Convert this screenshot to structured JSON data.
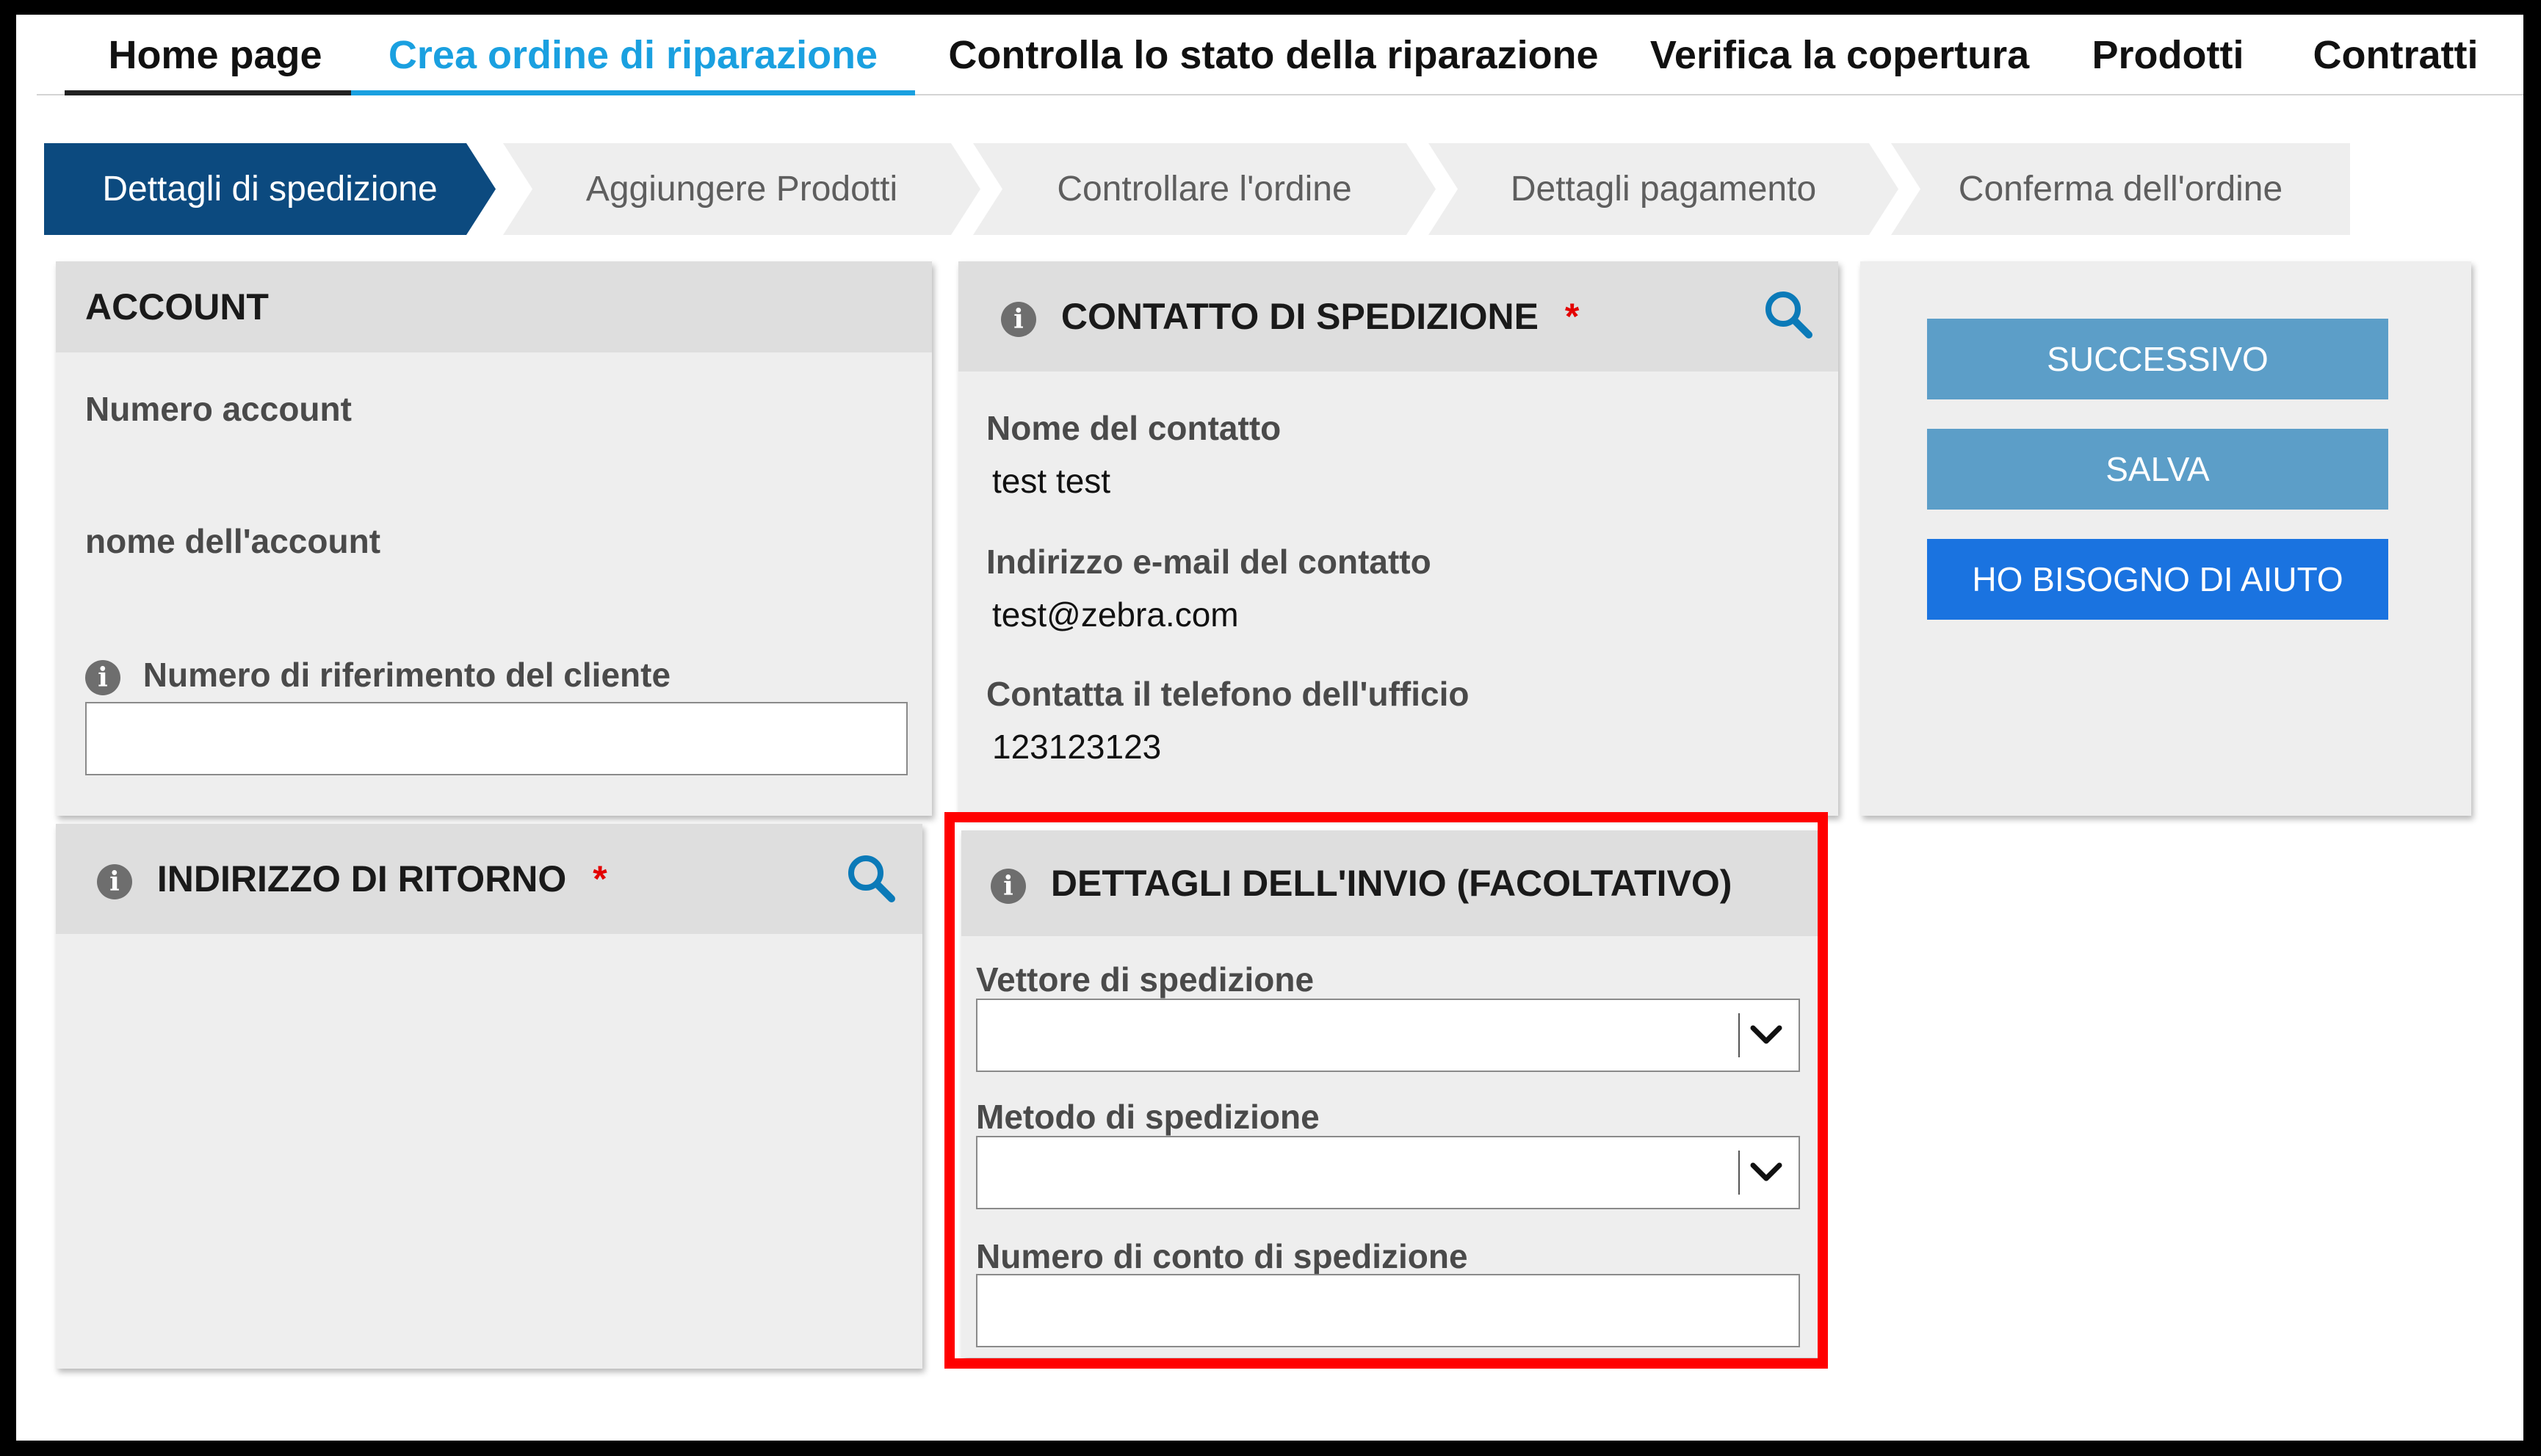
{
  "nav": {
    "tabs": [
      {
        "label": "Home page"
      },
      {
        "label": "Crea ordine di riparazione"
      },
      {
        "label": "Controlla lo stato della riparazione"
      },
      {
        "label": "Verifica la copertura"
      },
      {
        "label": "Prodotti"
      },
      {
        "label": "Contratti"
      }
    ],
    "active_tab": "Crea ordine di riparazione",
    "active_color": "#1aa0e0"
  },
  "stepper": {
    "steps": [
      {
        "label": "Dettagli di spedizione"
      },
      {
        "label": "Aggiungere Prodotti"
      },
      {
        "label": "Controllare l'ordine"
      },
      {
        "label": "Dettagli pagamento"
      },
      {
        "label": "Conferma dell'ordine"
      }
    ],
    "active_step": "Dettagli di spedizione",
    "active_color": "#0c4a7f"
  },
  "account": {
    "title": "ACCOUNT",
    "account_number_label": "Numero account",
    "account_name_label": "nome dell'account",
    "customer_ref_label": "Numero di riferimento del cliente",
    "customer_ref_value": ""
  },
  "contact": {
    "title": "CONTATTO DI SPEDIZIONE",
    "required_marker": "*",
    "name_label": "Nome del contatto",
    "name_value": "test test",
    "email_label": "Indirizzo e-mail del contatto",
    "email_value": "test@zebra.com",
    "phone_label": "Contatta il telefono dell'ufficio",
    "phone_value": "123123123"
  },
  "actions": {
    "next_label": "SUCCESSIVO",
    "save_label": "SALVA",
    "help_label": "HO BISOGNO DI AIUTO"
  },
  "return_address": {
    "title": "INDIRIZZO DI RITORNO",
    "required_marker": "*"
  },
  "shipping_details": {
    "title": "DETTAGLI DELL'INVIO (FACOLTATIVO)",
    "carrier_label": "Vettore di spedizione",
    "carrier_value": "",
    "method_label": "Metodo di spedizione",
    "method_value": "",
    "account_number_label": "Numero di conto di spedizione",
    "account_number_value": "",
    "highlight_color": "#ff0000"
  },
  "icons": [
    "info-icon",
    "search-icon",
    "chevron-down-icon"
  ]
}
